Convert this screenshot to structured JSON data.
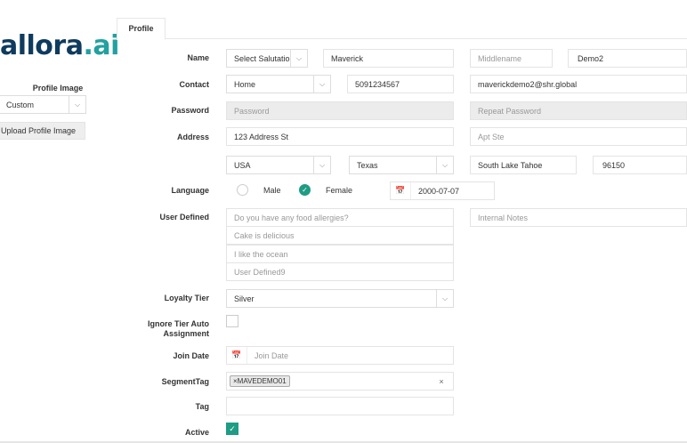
{
  "brand": {
    "logo_main": "allora",
    "logo_dot": ".ai"
  },
  "sidebar": {
    "profile_image_label": "Profile Image",
    "image_source_value": "Custom",
    "upload_button_label": "Upload Profile Image"
  },
  "tabs": {
    "profile": "Profile"
  },
  "labels": {
    "name": "Name",
    "contact": "Contact",
    "password": "Password",
    "address": "Address",
    "language": "Language",
    "user_defined": "User Defined",
    "loyalty_tier": "Loyalty Tier",
    "ignore_tier_line1": "Ignore Tier Auto",
    "ignore_tier_line2": "Assignment",
    "join_date": "Join Date",
    "segment_tag": "SegmentTag",
    "tag": "Tag",
    "active": "Active"
  },
  "name": {
    "salutation_value": "Select Salutatio",
    "first": "Maverick",
    "middle_placeholder": "Middlename",
    "last": "Demo2"
  },
  "contact": {
    "type_value": "Home",
    "phone": "5091234567",
    "email": "maverickdemo2@shr.global"
  },
  "password": {
    "placeholder": "Password",
    "repeat_placeholder": "Repeat Password"
  },
  "address": {
    "line1": "123 Address St",
    "apt_placeholder": "Apt Ste",
    "country": "USA",
    "state": "Texas",
    "city": "South Lake Tahoe",
    "zip": "96150"
  },
  "language": {
    "option_male": "Male",
    "option_female": "Female",
    "selected": "Female",
    "birthdate": "2000-07-07"
  },
  "user_defined": {
    "fields": [
      "Do you have any food allergies?",
      "Cake is delicious",
      "I like the ocean",
      "User Defined9"
    ],
    "notes_placeholder": "Internal Notes"
  },
  "loyalty": {
    "tier_value": "Silver"
  },
  "ignore_tier": {
    "checked": false
  },
  "join_date": {
    "placeholder": "Join Date"
  },
  "segment_tag": {
    "tag_remove": "×",
    "tag_text": "MAVEDEMO01",
    "clear_symbol": "×"
  },
  "active": {
    "checked": true
  },
  "icons": {
    "chevron": "chevron-down-icon",
    "calendar": "calendar-icon",
    "check": "check-icon"
  },
  "colors": {
    "accent": "#1e9c84",
    "logo": "#0e3b5e",
    "logo_dot": "#23a0a0"
  }
}
